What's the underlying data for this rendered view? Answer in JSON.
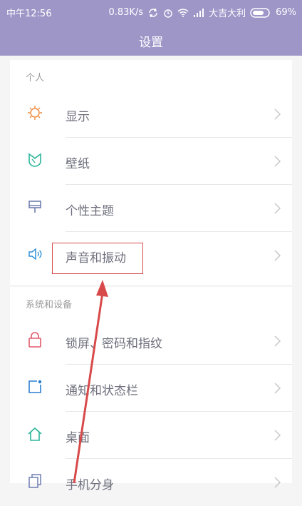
{
  "status_bar": {
    "time": "中午12:56",
    "speed": "0.83K/s",
    "carrier": "大吉大利",
    "battery": "69%"
  },
  "header": {
    "title": "设置"
  },
  "sections": [
    {
      "title": "个人",
      "items": [
        {
          "label": "显示",
          "icon": "sun-icon"
        },
        {
          "label": "壁纸",
          "icon": "wallpaper-icon"
        },
        {
          "label": "个性主题",
          "icon": "theme-brush-icon"
        },
        {
          "label": "声音和振动",
          "icon": "speaker-icon"
        }
      ]
    },
    {
      "title": "系统和设备",
      "items": [
        {
          "label": "锁屏、密码和指纹",
          "icon": "lock-icon"
        },
        {
          "label": "通知和状态栏",
          "icon": "notification-icon"
        },
        {
          "label": "桌面",
          "icon": "home-icon"
        },
        {
          "label": "手机分身",
          "icon": "phone-clone-icon"
        }
      ]
    }
  ],
  "colors": {
    "header": "#9f96c8",
    "sun": "#f08a3c",
    "wallpaper": "#2bb59a",
    "theme": "#6f7fb0",
    "speaker": "#2f8fd8",
    "lock": "#e05a6a",
    "notification": "#2a7fd0",
    "home": "#2bb59a",
    "annotation": "#d84a4a"
  }
}
